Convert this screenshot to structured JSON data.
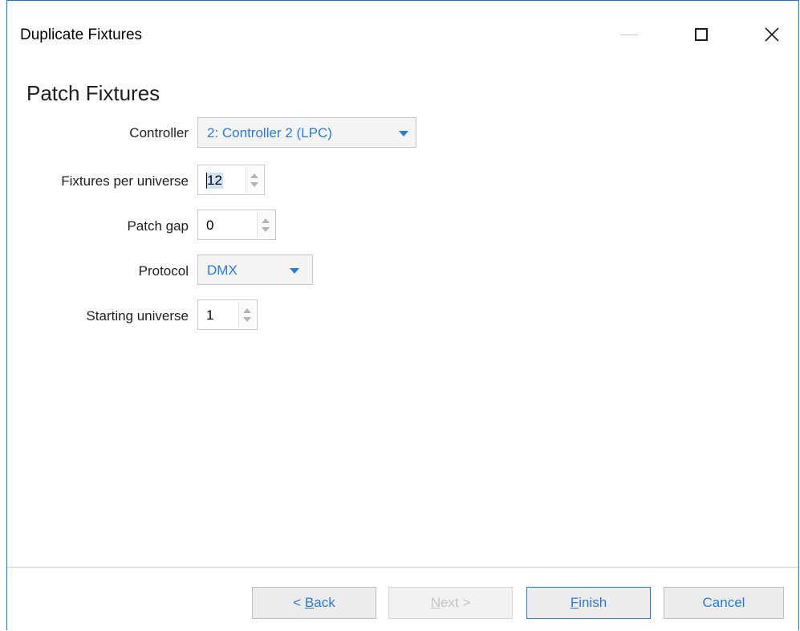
{
  "window": {
    "title": "Duplicate Fixtures"
  },
  "page": {
    "heading": "Patch Fixtures"
  },
  "form": {
    "controller": {
      "label": "Controller",
      "value": "2: Controller 2 (LPC)"
    },
    "fixtures_per_universe": {
      "label": "Fixtures per universe",
      "value": "12"
    },
    "patch_gap": {
      "label": "Patch gap",
      "value": "0"
    },
    "protocol": {
      "label": "Protocol",
      "value": "DMX"
    },
    "starting_universe": {
      "label": "Starting universe",
      "value": "1"
    }
  },
  "buttons": {
    "back_prefix": "< ",
    "back_mnemonic": "B",
    "back_rest": "ack",
    "next_mnemonic": "N",
    "next_rest": "ext >",
    "finish_mnemonic": "F",
    "finish_rest": "inish",
    "cancel": "Cancel"
  },
  "colors": {
    "accent": "#2b7bd6",
    "window_border": "#1a73e8",
    "disabled_text": "#c4c4c4"
  },
  "icons": {
    "minimize": "minimize-icon",
    "maximize": "maximize-icon",
    "close": "close-icon",
    "dropdown": "chevron-down-icon"
  }
}
